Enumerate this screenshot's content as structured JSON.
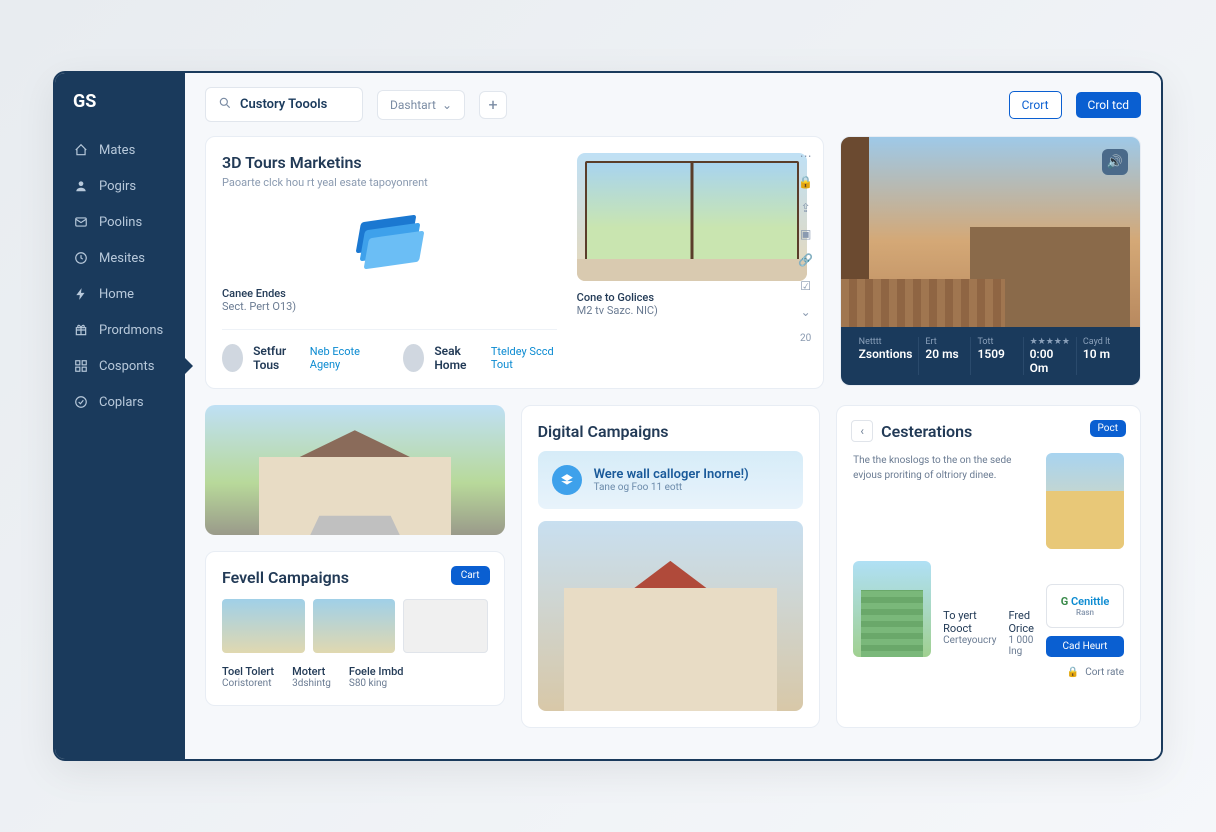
{
  "logo": "GS",
  "nav": [
    {
      "label": "Mates",
      "icon": "home-icon"
    },
    {
      "label": "Pogirs",
      "icon": "user-icon"
    },
    {
      "label": "Poolins",
      "icon": "mail-icon"
    },
    {
      "label": "Mesites",
      "icon": "clock-icon"
    },
    {
      "label": "Home",
      "icon": "bolt-icon"
    },
    {
      "label": "Prordmons",
      "icon": "gift-icon"
    },
    {
      "label": "Cosponts",
      "icon": "grid-icon"
    },
    {
      "label": "Coplars",
      "icon": "check-icon"
    }
  ],
  "topbar": {
    "search_value": "Custory Toools",
    "dropdown_label": "Dashtart",
    "btn_outline": "Crort",
    "btn_primary": "Crol tcd"
  },
  "tours": {
    "title": "3D Tours Marketins",
    "subtitle": "Paoarte clck hou rt yeal esate tapoyonrent",
    "left_meta_1": "Canee Endes",
    "left_meta_2": "Sect. Pert O13)",
    "right_meta_1": "Cone to Golices",
    "right_meta_2": "M2 tv Sazc. NIC)",
    "agent1_name": "Setfur Tous",
    "agent1_tag": "Neb Ecote Ageny",
    "agent2_name": "Seak Home",
    "agent2_tag": "Tteldey Sccd Tout",
    "right_count": "20"
  },
  "hero": {
    "stats": [
      {
        "label": "Netttt",
        "value": "Zsontions"
      },
      {
        "label": "Ert",
        "value": "20 ms"
      },
      {
        "label": "Tott",
        "value": "1509"
      },
      {
        "label": "★★★★★",
        "value": "0:00 Om"
      },
      {
        "label": "Cayd lt",
        "value": "10 m"
      }
    ]
  },
  "fevell": {
    "title": "Fevell Campaigns",
    "btn": "Cart",
    "stats": [
      {
        "h": "Toel Tolert",
        "s": "Coristorent"
      },
      {
        "h": "Motert",
        "s": "3dshintg"
      },
      {
        "h": "Foele Imbd",
        "s": "S80 king"
      }
    ]
  },
  "digital": {
    "title": "Digital Campaigns",
    "banner_title": "Were wall calloger Inorne!)",
    "banner_sub": "Tane og Foo 11 eott"
  },
  "cest": {
    "title": "Cesterations",
    "btn": "Poct",
    "body_text": "The the knoslogs to the on the sede evjous proriting of oltriory dinee.",
    "stat1_h": "To yert Rooct",
    "stat1_s": "Certeyoucry",
    "stat2_h": "Fred Orice",
    "stat2_s": "1 000 Ing",
    "brand": "Cenittle",
    "brand_sub": "Rasn",
    "cta": "Cad Heurt",
    "footer": "Cort rate"
  }
}
